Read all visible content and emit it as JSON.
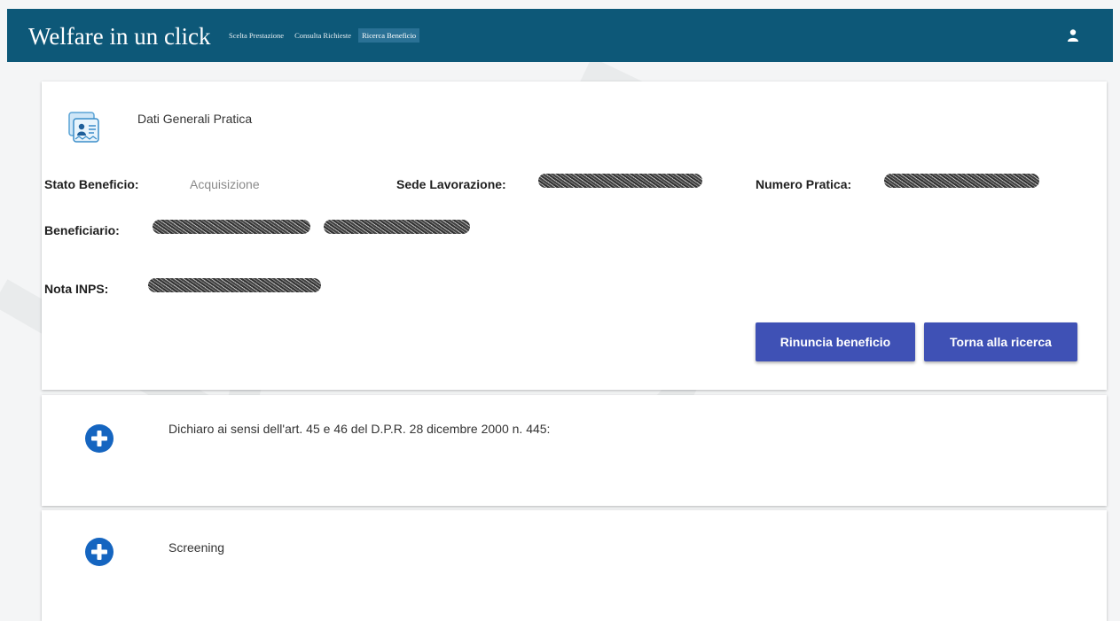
{
  "header": {
    "title": "Welfare in un click",
    "nav": [
      "Scelta Prestazione",
      "Consulta Richieste",
      "Ricerca Beneficio"
    ],
    "active_nav": "Ricerca Beneficio"
  },
  "pratica": {
    "title": "Dati Generali Pratica",
    "stato_label": "Stato Beneficio:",
    "stato_value": "Acquisizione",
    "sede_label": "Sede Lavorazione:",
    "numero_label": "Numero Pratica:",
    "beneficiario_label": "Beneficiario:",
    "nota_label": "Nota INPS:"
  },
  "actions": {
    "rinuncia": "Rinuncia beneficio",
    "torna": "Torna alla ricerca"
  },
  "sections": [
    {
      "text": "Dichiaro ai sensi dell'art. 45 e 46 del D.P.R. 28 dicembre 2000 n. 445:"
    },
    {
      "text": "Screening"
    }
  ],
  "colors": {
    "topbar": "#0d5878",
    "button": "#3f51b5",
    "plus": "#1565c0"
  }
}
